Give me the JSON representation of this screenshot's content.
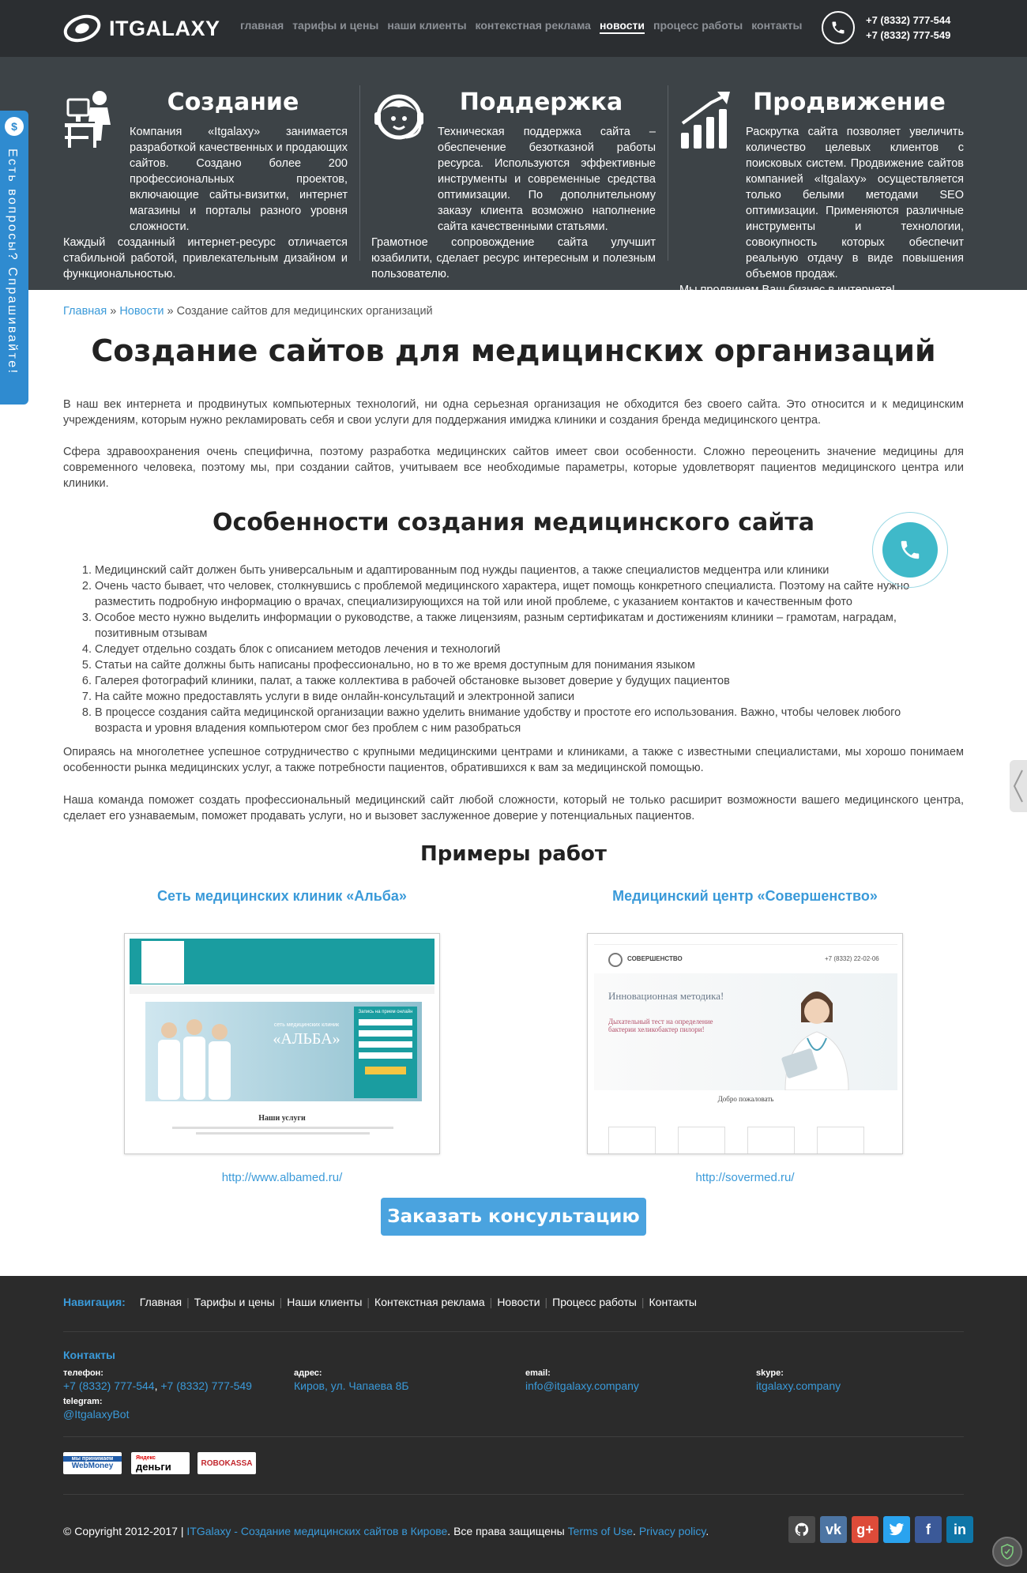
{
  "header": {
    "logo_text": "ITGALAXY",
    "nav": [
      "главная",
      "тарифы и цены",
      "наши клиенты",
      "контекстная реклама",
      "новости",
      "процесс работы",
      "контакты"
    ],
    "active_nav": "новости",
    "phones": [
      "+7 (8332) 777-544",
      "+7 (8332) 777-549"
    ]
  },
  "features": [
    {
      "title": "Создание",
      "icon": "workstation-icon",
      "text": [
        "Компания «Itgalaxy» занимается разработкой качественных и продающих сайтов. Создано более 200 профессиональных проектов, включающие сайты-визитки, интернет магазины и порталы разного уровня сложности.",
        "Каждый созданный интернет-ресурс отличается стабильной работой, привлекательным дизайном и функциональностью."
      ]
    },
    {
      "title": "Поддержка",
      "icon": "support-headset-icon",
      "text": [
        "Техническая поддержка сайта – обеспечение безотказной работы ресурса. Используются эффективные инструменты и современные средства оптимизации. По дополнительному заказу клиента возможно наполнение сайта качественными статьями.",
        "Грамотное сопровождение сайта улучшит юзабилити, сделает ресурс интересным и полезным пользователю."
      ]
    },
    {
      "title": "Продвижение",
      "icon": "growth-chart-icon",
      "text": [
        "Раскрутка сайта позволяет увеличить количество целевых клиентов с поисковых систем. Продвижение сайтов компанией «Itgalaxy» осуществляется только белыми методами SEO оптимизации. Применяются различные инструменты и технологии, совокупность которых обеспечит реальную отдачу в виде повышения объемов продаж.",
        "Мы продвинем Ваш бизнес в интернете!"
      ]
    }
  ],
  "side_tab": {
    "icon_glyph": "$",
    "text": "Есть вопросы? Спрашивайте!"
  },
  "breadcrumb": {
    "home": "Главная",
    "sep": " » ",
    "news": "Новости",
    "current": "Создание сайтов для медицинских организаций"
  },
  "article": {
    "title": "Создание сайтов для медицинских организаций",
    "intro_1": "В наш век интернета и продвинутых компьютерных технологий, ни одна серьезная организация не обходится без своего сайта. Это относится и к медицинским учреждениям, которым нужно рекламировать себя и свои услуги для поддержания имиджа клиники и создания бренда медицинского центра.",
    "intro_2": "Сфера здравоохранения очень специфична, поэтому разработка медицинских сайтов имеет свои особенности. Сложно переоценить значение медицины для современного человека, поэтому мы, при создании сайтов, учитываем все необходимые параметры, которые удовлетворят пациентов медицинского центра или клиники.",
    "subtitle": "Особенности создания медицинского сайта",
    "list": [
      "Медицинский сайт должен быть универсальным и адаптированным под нужды пациентов, а также специалистов медцентра или клиники",
      "Очень часто бывает, что человек, столкнувшись с проблемой медицинского характера, ищет помощь конкретного специалиста. Поэтому на сайте нужно разместить подробную информацию о врачах, специализирующихся на той или иной проблеме, с указанием контактов и качественным фото",
      "Особое место нужно выделить информации о руководстве, а также лицензиям, разным сертификатам и достижениям клиники – грамотам, наградам, позитивным отзывам",
      "Следует отдельно создать блок с описанием методов лечения и технологий",
      "Статьи на сайте должны быть написаны профессионально, но в то же время доступным для понимания языком",
      "Галерея фотографий клиники, палат, а также коллектива в рабочей обстановке вызовет доверие у будущих пациентов",
      "На сайте можно предоставлять услуги в виде онлайн-консультаций и электронной записи",
      "В процессе создания сайта медицинской организации важно уделить внимание удобству и простоте его использования. Важно, чтобы человек любого возраста и уровня владения компьютером смог без проблем с ним разобраться"
    ],
    "outro_1": "Опираясь на многолетнее успешное сотрудничество с крупными медицинскими центрами и клиниками, а также с известными специалистами, мы хорошо понимаем особенности рынка медицинских услуг, а также потребности пациентов, обратившихся к вам за медицинской помощью.",
    "outro_2": "Наша команда поможет создать профессиональный медицинский сайт любой сложности, который не только расширит возможности вашего медицинского центра, сделает его узнаваемым, поможет продавать услуги, но и вызовет заслуженное доверие у потенциальных пациентов."
  },
  "examples": {
    "title": "Примеры работ",
    "items": [
      {
        "name": "Сеть медицинских клиник «Альба»",
        "url": "http://www.albamed.ru/",
        "shot": {
          "banner": "«АЛЬБА»",
          "banner_sub": "сеть медицинских клиник",
          "form_title": "Запись на прием онлайн",
          "section": "Наши услуги"
        }
      },
      {
        "name": "Медицинский центр «Совершенство»",
        "url": "http://sovermed.ru/",
        "shot": {
          "brand": "СОВЕРШЕНСТВО",
          "phone": "+7 (8332) 22-02-06",
          "headline": "Инновационная методика!",
          "subhead": "Дыхательный тест на определение бактерии хеликобактер пилори!",
          "welcome": "Добро пожаловать"
        }
      }
    ]
  },
  "cta": {
    "label": "Заказать консультацию"
  },
  "footer": {
    "nav_label": "Навигация:",
    "nav": [
      "Главная",
      "Тарифы и цены",
      "Наши клиенты",
      "Контекстная реклама",
      "Новости",
      "Процесс работы",
      "Контакты"
    ],
    "contacts_title": "Контакты",
    "phone_label": "телефон:",
    "phone_1": "+7 (8332) 777-544",
    "phone_2": "+7 (8332) 777-549",
    "telegram_label": "telegram:",
    "telegram": "@ItgalaxyBot",
    "address_label": "адрес:",
    "address": "Киров, ул. Чапаева 8Б",
    "email_label": "email:",
    "email": "info@itgalaxy.company",
    "skype_label": "skype:",
    "skype": "itgalaxy.company",
    "payments": {
      "webmoney_top": "мы принимаем",
      "webmoney": "WebMoney",
      "yandex_top": "Яндекс",
      "yandex": "деньги",
      "robokassa": "ROBOKASSA"
    },
    "copyright_prefix": "© Copyright 2012-2017 | ",
    "copyright_link": "ITGalaxy - Создание медицинских сайтов в Кирове",
    "copyright_mid": ". Все права защищены ",
    "terms": "Terms of Use",
    "dot": ". ",
    "privacy": "Privacy policy",
    "end": ".",
    "socials": [
      {
        "icon": "github-icon",
        "glyph": "",
        "color": "#4a4a4a"
      },
      {
        "icon": "vk-icon",
        "glyph": "vk",
        "color": "#4d75a3"
      },
      {
        "icon": "googleplus-icon",
        "glyph": "g+",
        "color": "#dd4b39"
      },
      {
        "icon": "twitter-icon",
        "glyph": "",
        "color": "#2aa3ef"
      },
      {
        "icon": "facebook-icon",
        "glyph": "f",
        "color": "#3b5998"
      },
      {
        "icon": "linkedin-icon",
        "glyph": "in",
        "color": "#0e76a8"
      }
    ]
  },
  "colors": {
    "header_bg": "#2b2e31",
    "features_bg": "#3d4347",
    "accent": "#3a9ad9",
    "footer_bg": "#2b2b2b",
    "call_button": "#3fb9c9"
  }
}
